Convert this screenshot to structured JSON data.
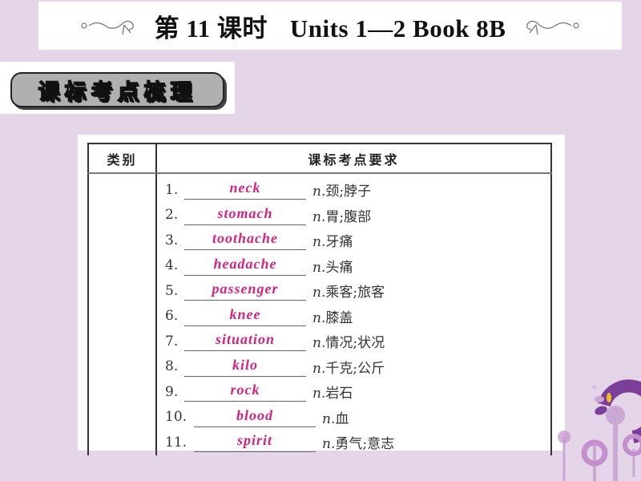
{
  "header": {
    "lesson": "第 11 课时",
    "units": "Units 1—2 Book 8B"
  },
  "section": {
    "title": "课标考点梳理"
  },
  "table": {
    "columns": [
      "类别",
      "课标考点要求"
    ],
    "category": "",
    "items": [
      {
        "num": "1.",
        "answer": "neck",
        "pos": "n.",
        "meaning": "颈;脖子"
      },
      {
        "num": "2.",
        "answer": "stomach",
        "pos": "n.",
        "meaning": "胃;腹部"
      },
      {
        "num": "3.",
        "answer": "toothache",
        "pos": "n.",
        "meaning": "牙痛"
      },
      {
        "num": "4.",
        "answer": "headache",
        "pos": "n.",
        "meaning": "头痛"
      },
      {
        "num": "5.",
        "answer": "passenger",
        "pos": "n.",
        "meaning": "乘客;旅客"
      },
      {
        "num": "6.",
        "answer": "knee",
        "pos": "n.",
        "meaning": "膝盖"
      },
      {
        "num": "7.",
        "answer": "situation",
        "pos": "n.",
        "meaning": "情况;状况"
      },
      {
        "num": "8.",
        "answer": "kilo",
        "pos": "n.",
        "meaning": "千克;公斤"
      },
      {
        "num": "9.",
        "answer": "rock",
        "pos": "n.",
        "meaning": "岩石"
      },
      {
        "num": "10.",
        "answer": "blood",
        "pos": "n.",
        "meaning": "血"
      },
      {
        "num": "11.",
        "answer": "spirit",
        "pos": "n.",
        "meaning": "勇气;意志"
      }
    ]
  },
  "colors": {
    "background": "#e4d5e8",
    "answer": "#d6227e",
    "decoration_purple": "#7b3f9a",
    "decoration_yellow": "#f0c020"
  }
}
